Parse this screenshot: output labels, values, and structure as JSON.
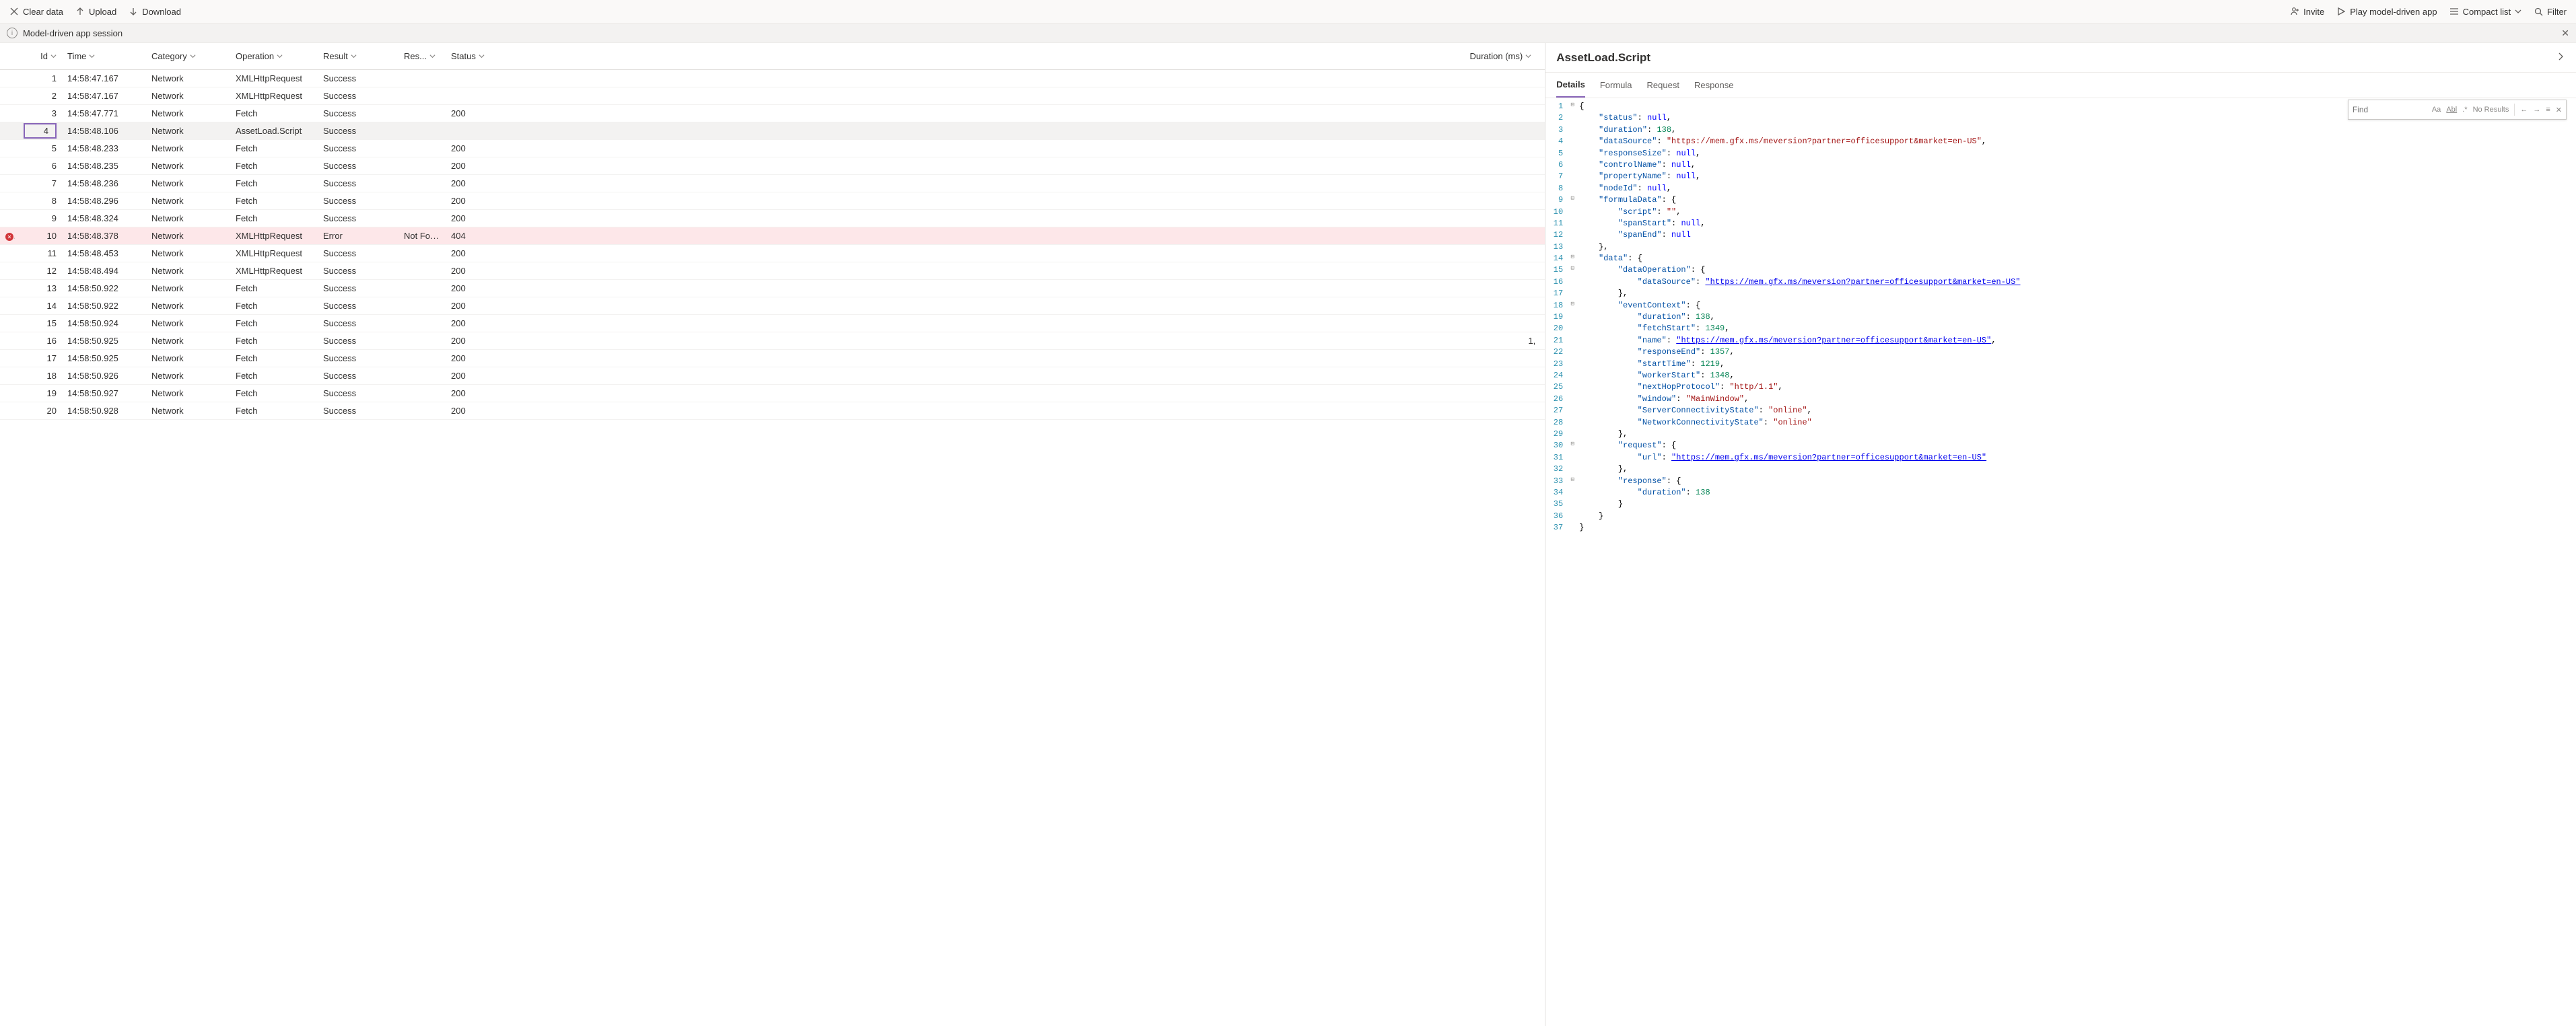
{
  "toolbar": {
    "clear": "Clear data",
    "upload": "Upload",
    "download": "Download",
    "invite": "Invite",
    "play": "Play model-driven app",
    "compact": "Compact list",
    "filter": "Filter"
  },
  "session": {
    "title": "Model-driven app session"
  },
  "columns": {
    "id": "Id",
    "time": "Time",
    "category": "Category",
    "operation": "Operation",
    "result": "Result",
    "res2": "Res...",
    "status": "Status",
    "duration": "Duration (ms)"
  },
  "rows": [
    {
      "id": "1",
      "time": "14:58:47.167",
      "cat": "Network",
      "op": "XMLHttpRequest",
      "res": "Success",
      "res2": "",
      "stat": "",
      "dur": ""
    },
    {
      "id": "2",
      "time": "14:58:47.167",
      "cat": "Network",
      "op": "XMLHttpRequest",
      "res": "Success",
      "res2": "",
      "stat": "",
      "dur": ""
    },
    {
      "id": "3",
      "time": "14:58:47.771",
      "cat": "Network",
      "op": "Fetch",
      "res": "Success",
      "res2": "",
      "stat": "200",
      "dur": ""
    },
    {
      "id": "4",
      "time": "14:58:48.106",
      "cat": "Network",
      "op": "AssetLoad.Script",
      "res": "Success",
      "res2": "",
      "stat": "",
      "dur": "",
      "selected": true
    },
    {
      "id": "5",
      "time": "14:58:48.233",
      "cat": "Network",
      "op": "Fetch",
      "res": "Success",
      "res2": "",
      "stat": "200",
      "dur": ""
    },
    {
      "id": "6",
      "time": "14:58:48.235",
      "cat": "Network",
      "op": "Fetch",
      "res": "Success",
      "res2": "",
      "stat": "200",
      "dur": ""
    },
    {
      "id": "7",
      "time": "14:58:48.236",
      "cat": "Network",
      "op": "Fetch",
      "res": "Success",
      "res2": "",
      "stat": "200",
      "dur": ""
    },
    {
      "id": "8",
      "time": "14:58:48.296",
      "cat": "Network",
      "op": "Fetch",
      "res": "Success",
      "res2": "",
      "stat": "200",
      "dur": ""
    },
    {
      "id": "9",
      "time": "14:58:48.324",
      "cat": "Network",
      "op": "Fetch",
      "res": "Success",
      "res2": "",
      "stat": "200",
      "dur": ""
    },
    {
      "id": "10",
      "time": "14:58:48.378",
      "cat": "Network",
      "op": "XMLHttpRequest",
      "res": "Error",
      "res2": "Not Fou…",
      "stat": "404",
      "dur": "",
      "error": true
    },
    {
      "id": "11",
      "time": "14:58:48.453",
      "cat": "Network",
      "op": "XMLHttpRequest",
      "res": "Success",
      "res2": "",
      "stat": "200",
      "dur": ""
    },
    {
      "id": "12",
      "time": "14:58:48.494",
      "cat": "Network",
      "op": "XMLHttpRequest",
      "res": "Success",
      "res2": "",
      "stat": "200",
      "dur": ""
    },
    {
      "id": "13",
      "time": "14:58:50.922",
      "cat": "Network",
      "op": "Fetch",
      "res": "Success",
      "res2": "",
      "stat": "200",
      "dur": ""
    },
    {
      "id": "14",
      "time": "14:58:50.922",
      "cat": "Network",
      "op": "Fetch",
      "res": "Success",
      "res2": "",
      "stat": "200",
      "dur": ""
    },
    {
      "id": "15",
      "time": "14:58:50.924",
      "cat": "Network",
      "op": "Fetch",
      "res": "Success",
      "res2": "",
      "stat": "200",
      "dur": ""
    },
    {
      "id": "16",
      "time": "14:58:50.925",
      "cat": "Network",
      "op": "Fetch",
      "res": "Success",
      "res2": "",
      "stat": "200",
      "dur": "1,"
    },
    {
      "id": "17",
      "time": "14:58:50.925",
      "cat": "Network",
      "op": "Fetch",
      "res": "Success",
      "res2": "",
      "stat": "200",
      "dur": ""
    },
    {
      "id": "18",
      "time": "14:58:50.926",
      "cat": "Network",
      "op": "Fetch",
      "res": "Success",
      "res2": "",
      "stat": "200",
      "dur": ""
    },
    {
      "id": "19",
      "time": "14:58:50.927",
      "cat": "Network",
      "op": "Fetch",
      "res": "Success",
      "res2": "",
      "stat": "200",
      "dur": ""
    },
    {
      "id": "20",
      "time": "14:58:50.928",
      "cat": "Network",
      "op": "Fetch",
      "res": "Success",
      "res2": "",
      "stat": "200",
      "dur": ""
    }
  ],
  "detail": {
    "title": "AssetLoad.Script",
    "tabs": {
      "details": "Details",
      "formula": "Formula",
      "request": "Request",
      "response": "Response"
    },
    "find": {
      "placeholder": "Find",
      "noresults": "No Results"
    }
  },
  "code": [
    {
      "n": 1,
      "f": "-",
      "t": [
        [
          "pun",
          "{"
        ]
      ]
    },
    {
      "n": 2,
      "t": [
        [
          "pun",
          "    "
        ],
        [
          "key",
          "\"status\""
        ],
        [
          "pun",
          ": "
        ],
        [
          "lit",
          "null"
        ],
        [
          "pun",
          ","
        ]
      ]
    },
    {
      "n": 3,
      "t": [
        [
          "pun",
          "    "
        ],
        [
          "key",
          "\"duration\""
        ],
        [
          "pun",
          ": "
        ],
        [
          "num",
          "138"
        ],
        [
          "pun",
          ","
        ]
      ]
    },
    {
      "n": 4,
      "t": [
        [
          "pun",
          "    "
        ],
        [
          "key",
          "\"dataSource\""
        ],
        [
          "pun",
          ": "
        ],
        [
          "str",
          "\"https://mem.gfx.ms/meversion?partner=officesupport&market=en-US\""
        ],
        [
          "pun",
          ","
        ]
      ]
    },
    {
      "n": 5,
      "t": [
        [
          "pun",
          "    "
        ],
        [
          "key",
          "\"responseSize\""
        ],
        [
          "pun",
          ": "
        ],
        [
          "lit",
          "null"
        ],
        [
          "pun",
          ","
        ]
      ]
    },
    {
      "n": 6,
      "t": [
        [
          "pun",
          "    "
        ],
        [
          "key",
          "\"controlName\""
        ],
        [
          "pun",
          ": "
        ],
        [
          "lit",
          "null"
        ],
        [
          "pun",
          ","
        ]
      ]
    },
    {
      "n": 7,
      "t": [
        [
          "pun",
          "    "
        ],
        [
          "key",
          "\"propertyName\""
        ],
        [
          "pun",
          ": "
        ],
        [
          "lit",
          "null"
        ],
        [
          "pun",
          ","
        ]
      ]
    },
    {
      "n": 8,
      "t": [
        [
          "pun",
          "    "
        ],
        [
          "key",
          "\"nodeId\""
        ],
        [
          "pun",
          ": "
        ],
        [
          "lit",
          "null"
        ],
        [
          "pun",
          ","
        ]
      ]
    },
    {
      "n": 9,
      "f": "-",
      "t": [
        [
          "pun",
          "    "
        ],
        [
          "key",
          "\"formulaData\""
        ],
        [
          "pun",
          ": {"
        ]
      ]
    },
    {
      "n": 10,
      "t": [
        [
          "pun",
          "        "
        ],
        [
          "key",
          "\"script\""
        ],
        [
          "pun",
          ": "
        ],
        [
          "str",
          "\"\""
        ],
        [
          "pun",
          ","
        ]
      ]
    },
    {
      "n": 11,
      "t": [
        [
          "pun",
          "        "
        ],
        [
          "key",
          "\"spanStart\""
        ],
        [
          "pun",
          ": "
        ],
        [
          "lit",
          "null"
        ],
        [
          "pun",
          ","
        ]
      ]
    },
    {
      "n": 12,
      "t": [
        [
          "pun",
          "        "
        ],
        [
          "key",
          "\"spanEnd\""
        ],
        [
          "pun",
          ": "
        ],
        [
          "lit",
          "null"
        ]
      ]
    },
    {
      "n": 13,
      "t": [
        [
          "pun",
          "    },"
        ]
      ]
    },
    {
      "n": 14,
      "f": "-",
      "t": [
        [
          "pun",
          "    "
        ],
        [
          "key",
          "\"data\""
        ],
        [
          "pun",
          ": {"
        ]
      ]
    },
    {
      "n": 15,
      "f": "-",
      "t": [
        [
          "pun",
          "        "
        ],
        [
          "key",
          "\"dataOperation\""
        ],
        [
          "pun",
          ": {"
        ]
      ]
    },
    {
      "n": 16,
      "t": [
        [
          "pun",
          "            "
        ],
        [
          "key",
          "\"dataSource\""
        ],
        [
          "pun",
          ": "
        ],
        [
          "url",
          "\"https://mem.gfx.ms/meversion?partner=officesupport&market=en-US\""
        ]
      ]
    },
    {
      "n": 17,
      "t": [
        [
          "pun",
          "        },"
        ]
      ]
    },
    {
      "n": 18,
      "f": "-",
      "t": [
        [
          "pun",
          "        "
        ],
        [
          "key",
          "\"eventContext\""
        ],
        [
          "pun",
          ": {"
        ]
      ]
    },
    {
      "n": 19,
      "t": [
        [
          "pun",
          "            "
        ],
        [
          "key",
          "\"duration\""
        ],
        [
          "pun",
          ": "
        ],
        [
          "num",
          "138"
        ],
        [
          "pun",
          ","
        ]
      ]
    },
    {
      "n": 20,
      "t": [
        [
          "pun",
          "            "
        ],
        [
          "key",
          "\"fetchStart\""
        ],
        [
          "pun",
          ": "
        ],
        [
          "num",
          "1349"
        ],
        [
          "pun",
          ","
        ]
      ]
    },
    {
      "n": 21,
      "t": [
        [
          "pun",
          "            "
        ],
        [
          "key",
          "\"name\""
        ],
        [
          "pun",
          ": "
        ],
        [
          "url",
          "\"https://mem.gfx.ms/meversion?partner=officesupport&market=en-US\""
        ],
        [
          "pun",
          ","
        ]
      ]
    },
    {
      "n": 22,
      "t": [
        [
          "pun",
          "            "
        ],
        [
          "key",
          "\"responseEnd\""
        ],
        [
          "pun",
          ": "
        ],
        [
          "num",
          "1357"
        ],
        [
          "pun",
          ","
        ]
      ]
    },
    {
      "n": 23,
      "t": [
        [
          "pun",
          "            "
        ],
        [
          "key",
          "\"startTime\""
        ],
        [
          "pun",
          ": "
        ],
        [
          "num",
          "1219"
        ],
        [
          "pun",
          ","
        ]
      ]
    },
    {
      "n": 24,
      "t": [
        [
          "pun",
          "            "
        ],
        [
          "key",
          "\"workerStart\""
        ],
        [
          "pun",
          ": "
        ],
        [
          "num",
          "1348"
        ],
        [
          "pun",
          ","
        ]
      ]
    },
    {
      "n": 25,
      "t": [
        [
          "pun",
          "            "
        ],
        [
          "key",
          "\"nextHopProtocol\""
        ],
        [
          "pun",
          ": "
        ],
        [
          "str",
          "\"http/1.1\""
        ],
        [
          "pun",
          ","
        ]
      ]
    },
    {
      "n": 26,
      "t": [
        [
          "pun",
          "            "
        ],
        [
          "key",
          "\"window\""
        ],
        [
          "pun",
          ": "
        ],
        [
          "str",
          "\"MainWindow\""
        ],
        [
          "pun",
          ","
        ]
      ]
    },
    {
      "n": 27,
      "t": [
        [
          "pun",
          "            "
        ],
        [
          "key",
          "\"ServerConnectivityState\""
        ],
        [
          "pun",
          ": "
        ],
        [
          "str",
          "\"online\""
        ],
        [
          "pun",
          ","
        ]
      ]
    },
    {
      "n": 28,
      "t": [
        [
          "pun",
          "            "
        ],
        [
          "key",
          "\"NetworkConnectivityState\""
        ],
        [
          "pun",
          ": "
        ],
        [
          "str",
          "\"online\""
        ]
      ]
    },
    {
      "n": 29,
      "t": [
        [
          "pun",
          "        },"
        ]
      ]
    },
    {
      "n": 30,
      "f": "-",
      "t": [
        [
          "pun",
          "        "
        ],
        [
          "key",
          "\"request\""
        ],
        [
          "pun",
          ": {"
        ]
      ]
    },
    {
      "n": 31,
      "t": [
        [
          "pun",
          "            "
        ],
        [
          "key",
          "\"url\""
        ],
        [
          "pun",
          ": "
        ],
        [
          "url",
          "\"https://mem.gfx.ms/meversion?partner=officesupport&market=en-US\""
        ]
      ]
    },
    {
      "n": 32,
      "t": [
        [
          "pun",
          "        },"
        ]
      ]
    },
    {
      "n": 33,
      "f": "-",
      "t": [
        [
          "pun",
          "        "
        ],
        [
          "key",
          "\"response\""
        ],
        [
          "pun",
          ": {"
        ]
      ]
    },
    {
      "n": 34,
      "t": [
        [
          "pun",
          "            "
        ],
        [
          "key",
          "\"duration\""
        ],
        [
          "pun",
          ": "
        ],
        [
          "num",
          "138"
        ]
      ]
    },
    {
      "n": 35,
      "t": [
        [
          "pun",
          "        }"
        ]
      ]
    },
    {
      "n": 36,
      "t": [
        [
          "pun",
          "    }"
        ]
      ]
    },
    {
      "n": 37,
      "t": [
        [
          "pun",
          "}"
        ]
      ]
    }
  ]
}
